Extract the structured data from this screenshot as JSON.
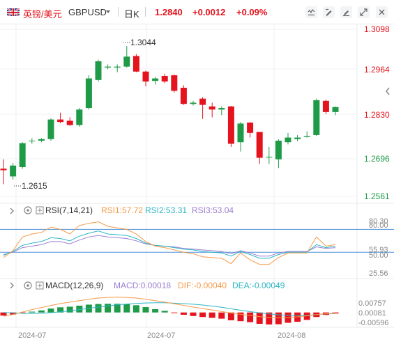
{
  "header": {
    "pair_name": "英镑/美元",
    "symbol": "GBPUSD",
    "interval": "日K",
    "price": "1.2840",
    "change": "+0.0012",
    "change_pct": "+0.09%",
    "tools": [
      "indicator-icon",
      "draw-icon",
      "draw-line-icon",
      "expand-icon",
      "close-icon"
    ]
  },
  "price_axis": [
    "1.3098",
    "1.2964",
    "1.2830",
    "1.2696",
    "1.2561"
  ],
  "annotations": {
    "high": "1.3044",
    "low": "1.2615"
  },
  "rsi_panel": {
    "label": "RSI(7,14,21)",
    "rsi1": "RSI1:57.72",
    "rsi2": "RSI2:53.31",
    "rsi3": "RSI3:53.04",
    "axis": [
      "80.00",
      "80.30",
      "55.93",
      "50.00",
      "25.56"
    ]
  },
  "macd_panel": {
    "label": "MACD(12,26,9)",
    "macd": "MACD:0.00018",
    "dif": "DIF:-0.00040",
    "dea": "DEA:-0.00049",
    "axis": [
      "0.00757",
      "0.00081",
      "-0.00596"
    ]
  },
  "time_axis": [
    "2024-07",
    "2024-07",
    "2024-08"
  ],
  "colors": {
    "up": "#1f9b48",
    "down": "#e5131d",
    "accent": "#e5131d",
    "rsi1": "#f59a49",
    "rsi2": "#2bb5c4",
    "rsi3": "#9b7fd3",
    "macd_dif": "#f59a49",
    "macd_dea": "#2bb5c4"
  },
  "chart_data": {
    "type": "candlestick",
    "ylim": [
      1.2561,
      1.3098
    ],
    "candles": [
      {
        "o": 1.265,
        "h": 1.268,
        "l": 1.26,
        "c": 1.2645
      },
      {
        "o": 1.2625,
        "h": 1.2668,
        "l": 1.2615,
        "c": 1.266
      },
      {
        "o": 1.2655,
        "h": 1.2735,
        "l": 1.265,
        "c": 1.2732
      },
      {
        "o": 1.2738,
        "h": 1.2748,
        "l": 1.273,
        "c": 1.274
      },
      {
        "o": 1.274,
        "h": 1.2748,
        "l": 1.2735,
        "c": 1.2745
      },
      {
        "o": 1.2745,
        "h": 1.2812,
        "l": 1.274,
        "c": 1.2808
      },
      {
        "o": 1.2808,
        "h": 1.283,
        "l": 1.2796,
        "c": 1.28
      },
      {
        "o": 1.2804,
        "h": 1.2815,
        "l": 1.2788,
        "c": 1.279
      },
      {
        "o": 1.279,
        "h": 1.2845,
        "l": 1.2785,
        "c": 1.284
      },
      {
        "o": 1.2845,
        "h": 1.295,
        "l": 1.284,
        "c": 1.294
      },
      {
        "o": 1.2935,
        "h": 1.3,
        "l": 1.293,
        "c": 1.2995
      },
      {
        "o": 1.2975,
        "h": 1.2985,
        "l": 1.297,
        "c": 1.2978
      },
      {
        "o": 1.2975,
        "h": 1.2985,
        "l": 1.296,
        "c": 1.2978
      },
      {
        "o": 1.2978,
        "h": 1.3044,
        "l": 1.2975,
        "c": 1.301
      },
      {
        "o": 1.3012,
        "h": 1.3018,
        "l": 1.296,
        "c": 1.2962
      },
      {
        "o": 1.2962,
        "h": 1.2965,
        "l": 1.2915,
        "c": 1.293
      },
      {
        "o": 1.2932,
        "h": 1.2945,
        "l": 1.292,
        "c": 1.294
      },
      {
        "o": 1.2948,
        "h": 1.2955,
        "l": 1.2925,
        "c": 1.293
      },
      {
        "o": 1.295,
        "h": 1.2953,
        "l": 1.2895,
        "c": 1.29
      },
      {
        "o": 1.291,
        "h": 1.2918,
        "l": 1.2855,
        "c": 1.2858
      },
      {
        "o": 1.2858,
        "h": 1.2868,
        "l": 1.2853,
        "c": 1.2862
      },
      {
        "o": 1.2875,
        "h": 1.288,
        "l": 1.281,
        "c": 1.2855
      },
      {
        "o": 1.285,
        "h": 1.2862,
        "l": 1.2815,
        "c": 1.284
      },
      {
        "o": 1.284,
        "h": 1.285,
        "l": 1.2822,
        "c": 1.2845
      },
      {
        "o": 1.285,
        "h": 1.2852,
        "l": 1.272,
        "c": 1.273
      },
      {
        "o": 1.2735,
        "h": 1.28,
        "l": 1.2705,
        "c": 1.2795
      },
      {
        "o": 1.2798,
        "h": 1.28,
        "l": 1.275,
        "c": 1.2765
      },
      {
        "o": 1.2768,
        "h": 1.2768,
        "l": 1.2665,
        "c": 1.2685
      },
      {
        "o": 1.2688,
        "h": 1.272,
        "l": 1.2665,
        "c": 1.2688
      },
      {
        "o": 1.268,
        "h": 1.2745,
        "l": 1.2652,
        "c": 1.274
      },
      {
        "o": 1.2735,
        "h": 1.2765,
        "l": 1.2728,
        "c": 1.275
      },
      {
        "o": 1.2745,
        "h": 1.2758,
        "l": 1.2738,
        "c": 1.275
      },
      {
        "o": 1.2752,
        "h": 1.277,
        "l": 1.275,
        "c": 1.2755
      },
      {
        "o": 1.2758,
        "h": 1.2875,
        "l": 1.2755,
        "c": 1.287
      },
      {
        "o": 1.2868,
        "h": 1.2872,
        "l": 1.2825,
        "c": 1.2832
      },
      {
        "o": 1.2832,
        "h": 1.285,
        "l": 1.2822,
        "c": 1.2848
      }
    ],
    "rsi": {
      "ylim": [
        20,
        95
      ],
      "rsi1": [
        43,
        52,
        70,
        74,
        76,
        83,
        80,
        74,
        85,
        88,
        90,
        84,
        82,
        80,
        74,
        64,
        58,
        56,
        53,
        50,
        48,
        44,
        43,
        42,
        35,
        49,
        40,
        34,
        34,
        43,
        49,
        49,
        49,
        70,
        58,
        60
      ],
      "rsi2": [
        46,
        51,
        59,
        62,
        64,
        69,
        68,
        65,
        71,
        75,
        78,
        74,
        73,
        72,
        68,
        62,
        59,
        58,
        56,
        54,
        53,
        51,
        50,
        49,
        45,
        51,
        47,
        42,
        42,
        47,
        50,
        50,
        50,
        60,
        56,
        58
      ],
      "rsi3": [
        47,
        50,
        56,
        58,
        60,
        64,
        64,
        61,
        66,
        70,
        72,
        70,
        69,
        68,
        65,
        61,
        59,
        58,
        57,
        55,
        54,
        53,
        52,
        51,
        48,
        52,
        49,
        45,
        45,
        49,
        51,
        51,
        51,
        57,
        55,
        56
      ]
    },
    "macd": {
      "ylim": [
        -0.0065,
        0.008
      ],
      "hist": [
        -0.0015,
        -0.001,
        -0.0003,
        0.0004,
        0.001,
        0.0019,
        0.0025,
        0.0028,
        0.0033,
        0.0038,
        0.0041,
        0.0042,
        0.0042,
        0.0041,
        0.0035,
        0.0026,
        0.0016,
        0.0008,
        -0.0002,
        -0.0011,
        -0.0017,
        -0.0022,
        -0.0026,
        -0.003,
        -0.0038,
        -0.0042,
        -0.0047,
        -0.0055,
        -0.0058,
        -0.0057,
        -0.005,
        -0.0045,
        -0.0036,
        -0.0022,
        -0.0012,
        -0.0005
      ],
      "dif": [
        -0.0018,
        -0.001,
        0.0002,
        0.0014,
        0.0024,
        0.0034,
        0.0043,
        0.005,
        0.0057,
        0.0064,
        0.007,
        0.0073,
        0.0074,
        0.0073,
        0.007,
        0.0064,
        0.0057,
        0.005,
        0.0042,
        0.0034,
        0.0026,
        0.0019,
        0.0012,
        0.0005,
        -0.0003,
        -0.0009,
        -0.0014,
        -0.002,
        -0.0024,
        -0.0026,
        -0.0025,
        -0.0021,
        -0.0016,
        -0.001,
        -0.0006,
        -0.0004
      ],
      "dea": [
        0.0,
        -0.0002,
        -0.0004,
        -0.0005,
        -0.0004,
        -0.0001,
        0.0003,
        0.0008,
        0.0014,
        0.002,
        0.0026,
        0.0032,
        0.0037,
        0.0041,
        0.0044,
        0.0046,
        0.0047,
        0.0047,
        0.0045,
        0.0043,
        0.004,
        0.0036,
        0.0031,
        0.0025,
        0.0018,
        0.0011,
        0.0004,
        -0.0002,
        -0.0007,
        -0.0011,
        -0.0014,
        -0.0015,
        -0.0014,
        -0.001,
        -0.0007,
        -0.0005
      ]
    }
  }
}
